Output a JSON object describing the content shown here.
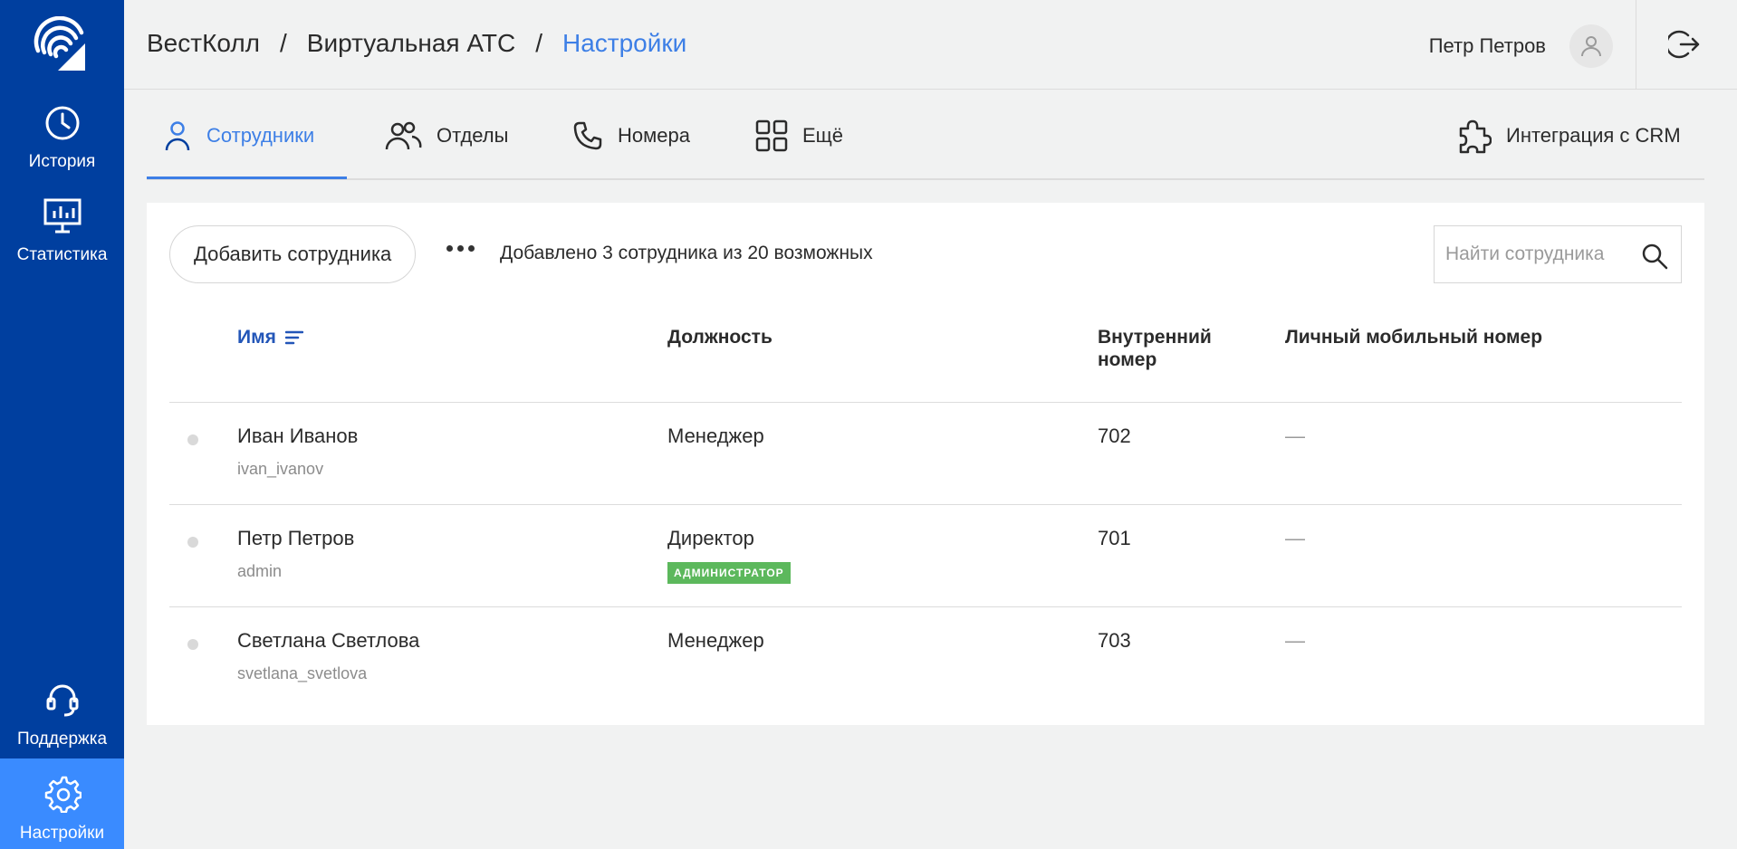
{
  "sidebar": {
    "items": [
      {
        "label": "История",
        "icon": "clock-icon"
      },
      {
        "label": "Статистика",
        "icon": "monitor-chart-icon"
      },
      {
        "label": "Поддержка",
        "icon": "headset-icon"
      },
      {
        "label": "Настройки",
        "icon": "gear-icon",
        "active": true
      }
    ]
  },
  "header": {
    "breadcrumb": [
      "ВестКолл",
      "Виртуальная АТС",
      "Настройки"
    ],
    "separator": "/",
    "user_name": "Петр Петров"
  },
  "tabs": [
    {
      "label": "Сотрудники",
      "icon": "person-icon",
      "active": true
    },
    {
      "label": "Отделы",
      "icon": "people-icon"
    },
    {
      "label": "Номера",
      "icon": "phone-icon"
    },
    {
      "label": "Ещё",
      "icon": "grid-icon"
    },
    {
      "label": "Интеграция с CRM",
      "icon": "puzzle-icon"
    }
  ],
  "toolbar": {
    "add_label": "Добавить сотрудника",
    "count_text": "Добавлено 3 сотрудника из 20 возможных",
    "search_placeholder": "Найти сотрудника"
  },
  "table": {
    "columns": [
      "Имя",
      "Должность",
      "Внутренний\nномер",
      "Личный мобильный номер"
    ],
    "col_ext_line1": "Внутренний",
    "col_ext_line2": "номер",
    "rows": [
      {
        "name": "Иван Иванов",
        "login": "ivan_ivanov",
        "position": "Менеджер",
        "ext": "702",
        "mobile": "—"
      },
      {
        "name": "Петр Петров",
        "login": "admin",
        "position": "Директор",
        "badge": "АДМИНИСТРАТОР",
        "ext": "701",
        "mobile": "—"
      },
      {
        "name": "Светлана Светлова",
        "login": "svetlana_svetlova",
        "position": "Менеджер",
        "ext": "703",
        "mobile": "—"
      }
    ]
  },
  "colors": {
    "sidebar_bg": "#003f9f",
    "accent": "#3d7fe6",
    "active_sidebar": "#3a8bff",
    "badge_green": "#5cb85c"
  }
}
